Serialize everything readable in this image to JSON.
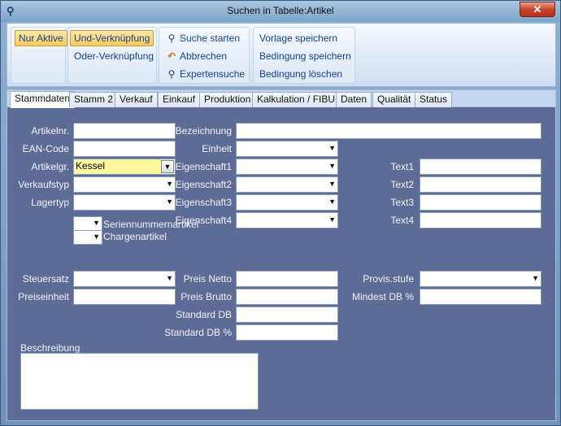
{
  "window": {
    "title": "Suchen in Tabelle:Artikel",
    "close_label": "✕"
  },
  "ribbon": {
    "nur_aktive": "Nur Aktive",
    "und_verknuepfung": "Und-Verknüpfung",
    "oder_verknuepfung": "Oder-Verknüpfung",
    "suche_starten": "Suche starten",
    "abbrechen": "Abbrechen",
    "expertensuche": "Expertensuche",
    "vorlage_speichern": "Vorlage speichern",
    "bedingung_speichern": "Bedingung speichern",
    "bedingung_loeschen": "Bedingung löschen"
  },
  "tabs": [
    "Stammdaten",
    "Stamm 2",
    "Verkauf",
    "Einkauf",
    "Produktion",
    "Kalkulation / FIBU",
    "Daten",
    "Qualität",
    "Status"
  ],
  "form": {
    "artikelnr": "Artikelnr.",
    "ean_code": "EAN-Code",
    "artikelgr": "Artikelgr.",
    "artikelgr_value": "Kessel",
    "verkaufstyp": "Verkaufstyp",
    "lagertyp": "Lagertyp",
    "seriennummernartikel": "Seriennummernartikel",
    "chargenartikel": "Chargenartikel",
    "bezeichnung": "Bezeichnung",
    "einheit": "Einheit",
    "eigenschaft1": "Eigenschaft1",
    "eigenschaft2": "Eigenschaft2",
    "eigenschaft3": "Eigenschaft3",
    "eigenschaft4": "Eigenschaft4",
    "text1": "Text1",
    "text2": "Text2",
    "text3": "Text3",
    "text4": "Text4",
    "steuersatz": "Steuersatz",
    "preiseinheit": "Preiseinheit",
    "preis_netto": "Preis Netto",
    "preis_brutto": "Preis Brutto",
    "standard_db": "Standard DB",
    "standard_db_pct": "Standard DB %",
    "provis_stufe": "Provis.stufe",
    "mindest_db_pct": "Mindest DB %",
    "beschreibung": "Beschreibung"
  }
}
